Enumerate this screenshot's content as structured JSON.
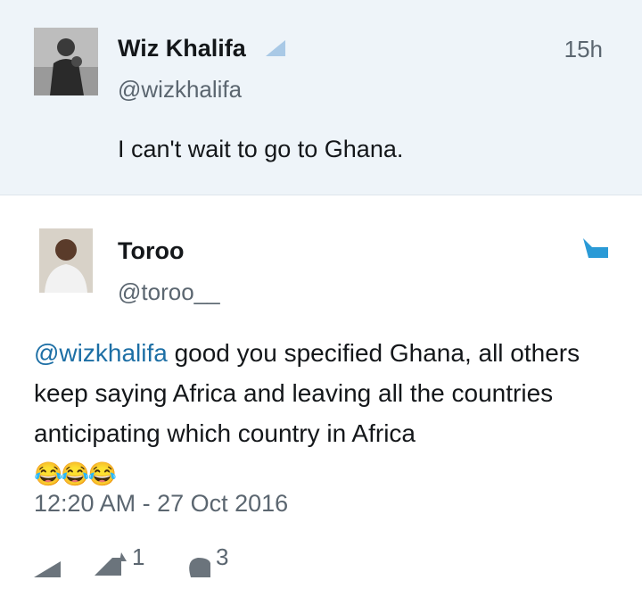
{
  "quoted_tweet": {
    "name": "Wiz Khalifa",
    "handle": "@wizkhalifa",
    "time": "15h",
    "text": "I can't wait to go to Ghana."
  },
  "reply_tweet": {
    "name": "Toroo",
    "handle": "@toroo__",
    "mention": "@wizkhalifa",
    "text": " good you specified Ghana, all others keep saying Africa and leaving all the countries anticipating which country in Africa",
    "emoji": "😂😂😂",
    "timestamp": "12:20  AM - 27 Oct 2016"
  },
  "actions": {
    "retweet_count": "1",
    "like_count": "3"
  },
  "icons": {
    "verified": "verified-badge-icon",
    "share": "share-icon",
    "reply": "reply-icon",
    "retweet": "retweet-icon",
    "like": "like-icon"
  },
  "colors": {
    "link": "#1d6fa5",
    "muted": "#5b6670",
    "quoted_bg": "#eef4f9",
    "badge": "#a9c9e6"
  }
}
